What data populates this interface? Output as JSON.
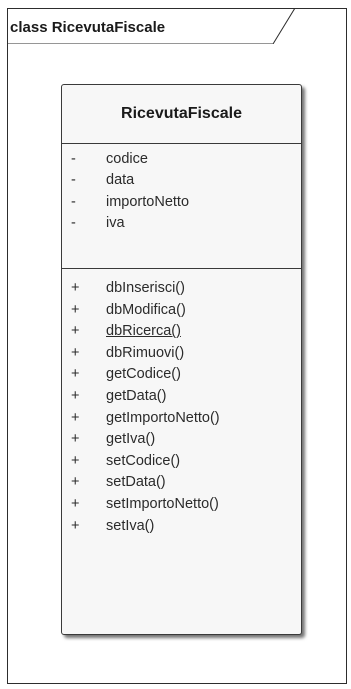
{
  "frame": {
    "title": "class RicevutaFiscale"
  },
  "class": {
    "name": "RicevutaFiscale",
    "attributes": [
      {
        "visibility": "-",
        "name": "codice"
      },
      {
        "visibility": "-",
        "name": "data"
      },
      {
        "visibility": "-",
        "name": "importoNetto"
      },
      {
        "visibility": "-",
        "name": "iva"
      }
    ],
    "operations": [
      {
        "visibility": "+",
        "name": "dbInserisci()"
      },
      {
        "visibility": "+",
        "name": "dbModifica()"
      },
      {
        "visibility": "+",
        "name": "dbRicerca()",
        "static": true
      },
      {
        "visibility": "+",
        "name": "dbRimuovi()"
      },
      {
        "visibility": "+",
        "name": "getCodice()"
      },
      {
        "visibility": "+",
        "name": "getData()"
      },
      {
        "visibility": "+",
        "name": "getImportoNetto()"
      },
      {
        "visibility": "+",
        "name": "getIva()"
      },
      {
        "visibility": "+",
        "name": "setCodice()"
      },
      {
        "visibility": "+",
        "name": "setData()"
      },
      {
        "visibility": "+",
        "name": "setImportoNetto()"
      },
      {
        "visibility": "+",
        "name": "setIva()"
      }
    ]
  }
}
